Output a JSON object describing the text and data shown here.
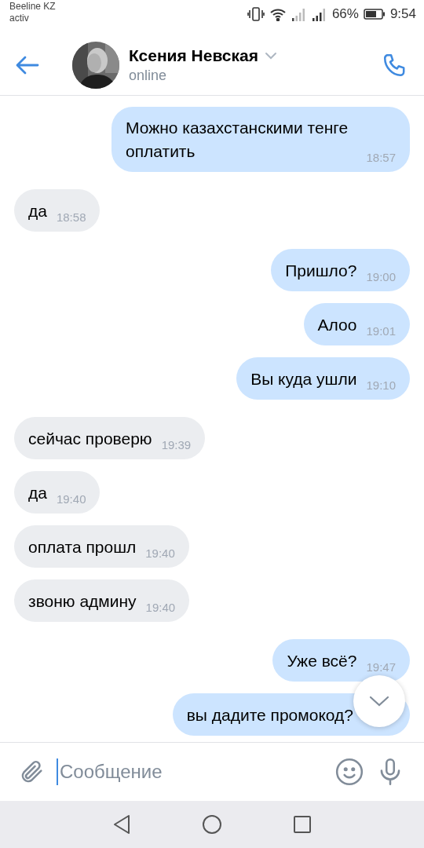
{
  "status_bar": {
    "carrier": "Beeline KZ",
    "carrier_sub": "activ",
    "battery": "66%",
    "time": "9:54"
  },
  "header": {
    "name": "Ксения Невская",
    "status": "online"
  },
  "messages": [
    {
      "kind": "outgoing",
      "text": "Можно казахстанскими тенге оплатить",
      "time": "18:57"
    },
    {
      "kind": "incoming",
      "text": "да",
      "time": "18:58"
    },
    {
      "kind": "outgoing",
      "text": "Пришло?",
      "time": "19:00"
    },
    {
      "kind": "outgoing",
      "text": "Алоо",
      "time": "19:01"
    },
    {
      "kind": "outgoing",
      "text": "Вы куда ушли",
      "time": "19:10"
    },
    {
      "kind": "incoming",
      "text": "сейчас проверю",
      "time": "19:39"
    },
    {
      "kind": "incoming",
      "text": "да",
      "time": "19:40"
    },
    {
      "kind": "incoming",
      "text": "оплата прошл",
      "time": "19:40"
    },
    {
      "kind": "incoming",
      "text": "звоню админу",
      "time": "19:40"
    },
    {
      "kind": "outgoing",
      "text": "Уже всё?",
      "time": "19:47"
    },
    {
      "kind": "outgoing",
      "text": "вы дадите промокод?"
    }
  ],
  "composer": {
    "placeholder": "Сообщение"
  }
}
